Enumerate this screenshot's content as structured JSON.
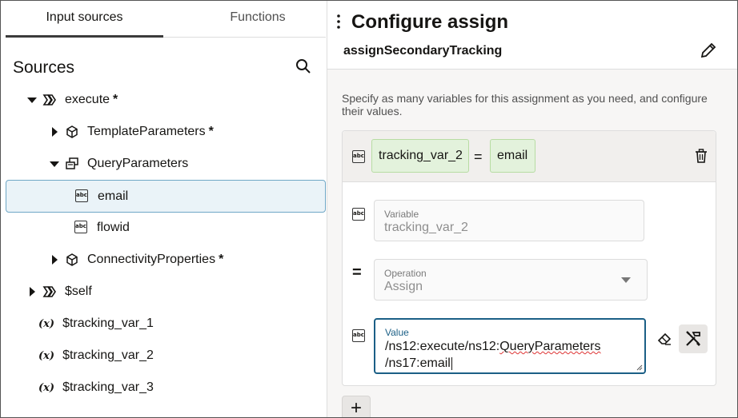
{
  "tabs": [
    {
      "label": "Input sources",
      "active": true
    },
    {
      "label": "Functions",
      "active": false
    }
  ],
  "sources": {
    "title": "Sources",
    "tree": [
      {
        "label": "execute",
        "required": "*",
        "icon": "message-icon",
        "expanded": true
      },
      {
        "label": "TemplateParameters",
        "required": "*",
        "icon": "cube-icon",
        "expanded": false
      },
      {
        "label": "QueryParameters",
        "required": "",
        "icon": "collection-icon",
        "expanded": true
      },
      {
        "label": "email",
        "required": "",
        "icon": "string-field-icon",
        "selected": true
      },
      {
        "label": "flowid",
        "required": "",
        "icon": "string-field-icon"
      },
      {
        "label": "ConnectivityProperties",
        "required": "*",
        "icon": "cube-icon",
        "expanded": false
      },
      {
        "label": "$self",
        "required": "",
        "icon": "message-icon",
        "expanded": false
      },
      {
        "label": "$tracking_var_1",
        "icon": "variable-icon",
        "prefix": "(x)"
      },
      {
        "label": "$tracking_var_2",
        "icon": "variable-icon",
        "prefix": "(x)"
      },
      {
        "label": "$tracking_var_3",
        "icon": "variable-icon",
        "prefix": "(x)"
      }
    ]
  },
  "configure": {
    "title": "Configure assign",
    "subtitle": "assignSecondaryTracking",
    "description": "Specify as many variables for this assignment as you need, and configure their values.",
    "summary": {
      "variable": "tracking_var_2",
      "operator": "=",
      "value": "email",
      "abc": "abc"
    },
    "variable_field": {
      "label": "Variable",
      "value": "tracking_var_2"
    },
    "operation_field": {
      "label": "Operation",
      "value": "Assign",
      "operator": "="
    },
    "value_field": {
      "label": "Value",
      "line1_prefix": "/ns12:execute/ns12:",
      "line1_squiggle": "QueryParameters",
      "line2": "/ns17:email"
    },
    "add_label": "+"
  },
  "colors": {
    "accent": "#1b5f86",
    "chip_bg": "#e3f2dc",
    "selected_row_bg": "#eaf3f8"
  }
}
